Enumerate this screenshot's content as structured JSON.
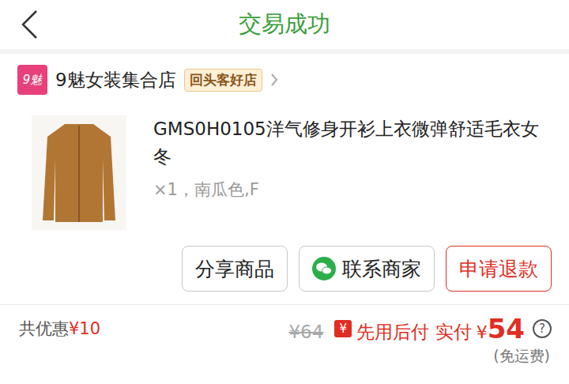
{
  "header": {
    "title": "交易成功"
  },
  "store": {
    "logo": "9魅",
    "name": "9魅女装集合店",
    "badge": "回头客好店"
  },
  "product": {
    "title": "GMS0H0105洋气修身开衫上衣微弹舒适毛衣女冬",
    "spec": "×1，南瓜色,F"
  },
  "buttons": [
    {
      "label": "分享商品",
      "kind": "plain"
    },
    {
      "label": "联系商家",
      "kind": "wechat"
    },
    {
      "label": "申请退款",
      "kind": "danger"
    }
  ],
  "summary": {
    "discount_label": "共优惠",
    "discount": "¥10",
    "original_price": "¥64",
    "pay_icon": "¥",
    "pay_label": "先用后付 实付",
    "currency": "¥",
    "paid": "54",
    "help": "?",
    "shipping": "(免运费)"
  }
}
